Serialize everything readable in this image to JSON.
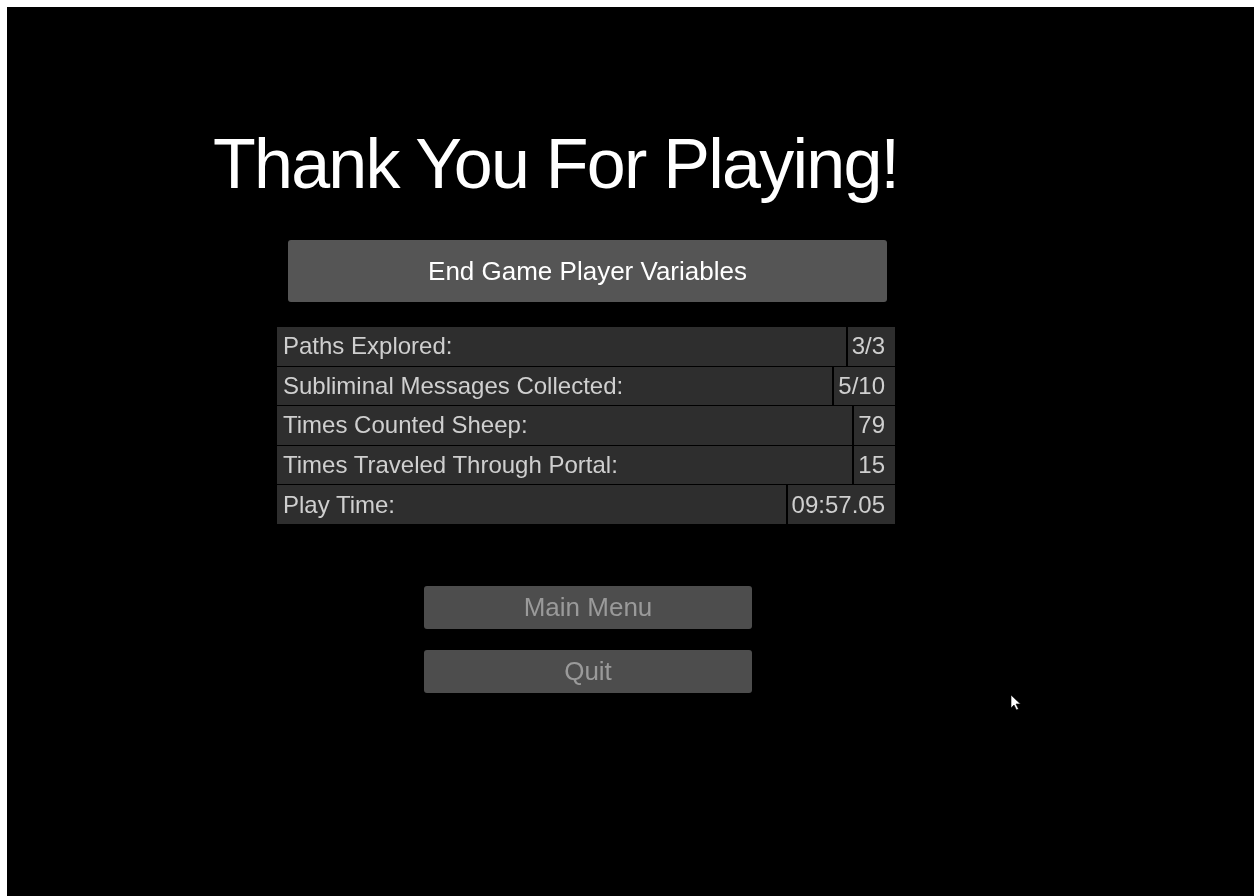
{
  "title": "Thank You For Playing!",
  "header": "End Game Player Variables",
  "stats": [
    {
      "label": "Paths Explored:",
      "value": "3/3"
    },
    {
      "label": "Subliminal Messages Collected:",
      "value": "5/10"
    },
    {
      "label": "Times Counted Sheep:",
      "value": "79"
    },
    {
      "label": "Times Traveled Through Portal:",
      "value": "15"
    },
    {
      "label": "Play Time:",
      "value": "09:57.05"
    }
  ],
  "buttons": [
    "Main Menu",
    "Quit"
  ]
}
